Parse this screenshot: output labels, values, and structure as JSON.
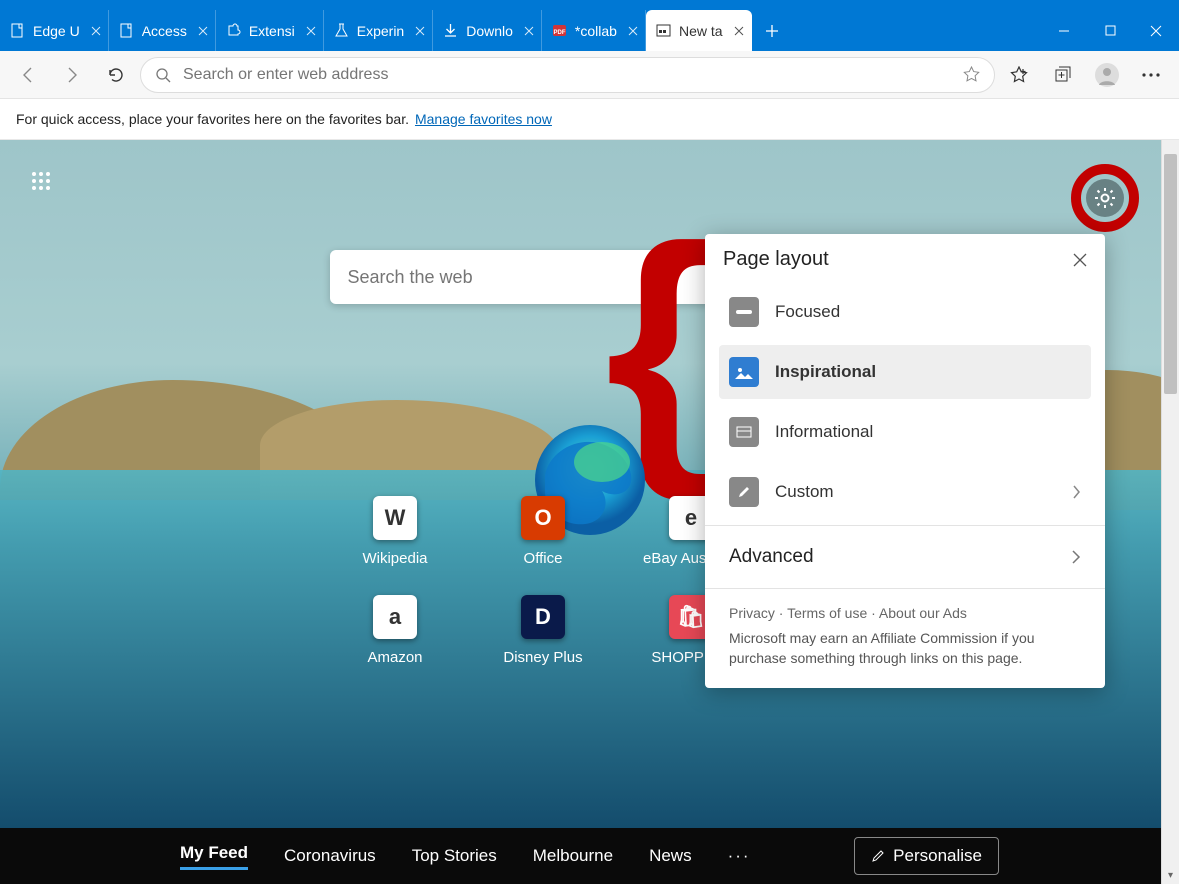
{
  "tabs": [
    {
      "label": "Edge U",
      "icon": "page"
    },
    {
      "label": "Access",
      "icon": "page"
    },
    {
      "label": "Extensi",
      "icon": "puzzle"
    },
    {
      "label": "Experin",
      "icon": "flask"
    },
    {
      "label": "Downlo",
      "icon": "download"
    },
    {
      "label": "*collab",
      "icon": "pdf"
    },
    {
      "label": "New ta",
      "icon": "ntp",
      "active": true
    }
  ],
  "addressbar": {
    "placeholder": "Search or enter web address"
  },
  "favbar": {
    "text": "For quick access, place your favorites here on the favorites bar.",
    "link": "Manage favorites now"
  },
  "ntp_search": {
    "placeholder": "Search the web"
  },
  "tiles": [
    {
      "label": "Wikipedia",
      "glyph": "W"
    },
    {
      "label": "Office",
      "glyph": "O",
      "bg": "#d83b01"
    },
    {
      "label": "eBay Australia",
      "glyph": "e"
    },
    {
      "label": "Amazon",
      "glyph": "a"
    },
    {
      "label": "Disney Plus",
      "glyph": "D",
      "bg": "#0a1a4a"
    },
    {
      "label": "SHOPPING",
      "glyph": "🛍",
      "bg": "#e74856"
    }
  ],
  "feed": {
    "items": [
      "My Feed",
      "Coronavirus",
      "Top Stories",
      "Melbourne",
      "News"
    ],
    "active": "My Feed",
    "personalise": "Personalise"
  },
  "popover": {
    "title": "Page layout",
    "options": [
      {
        "label": "Focused",
        "icon": "focused"
      },
      {
        "label": "Inspirational",
        "icon": "image",
        "selected": true
      },
      {
        "label": "Informational",
        "icon": "news"
      },
      {
        "label": "Custom",
        "icon": "edit",
        "chevron": true
      }
    ],
    "advanced": "Advanced",
    "links": [
      "Privacy",
      "Terms of use",
      "About our Ads"
    ],
    "disclaimer": "Microsoft may earn an Affiliate Commission if you purchase something through links on this page."
  }
}
